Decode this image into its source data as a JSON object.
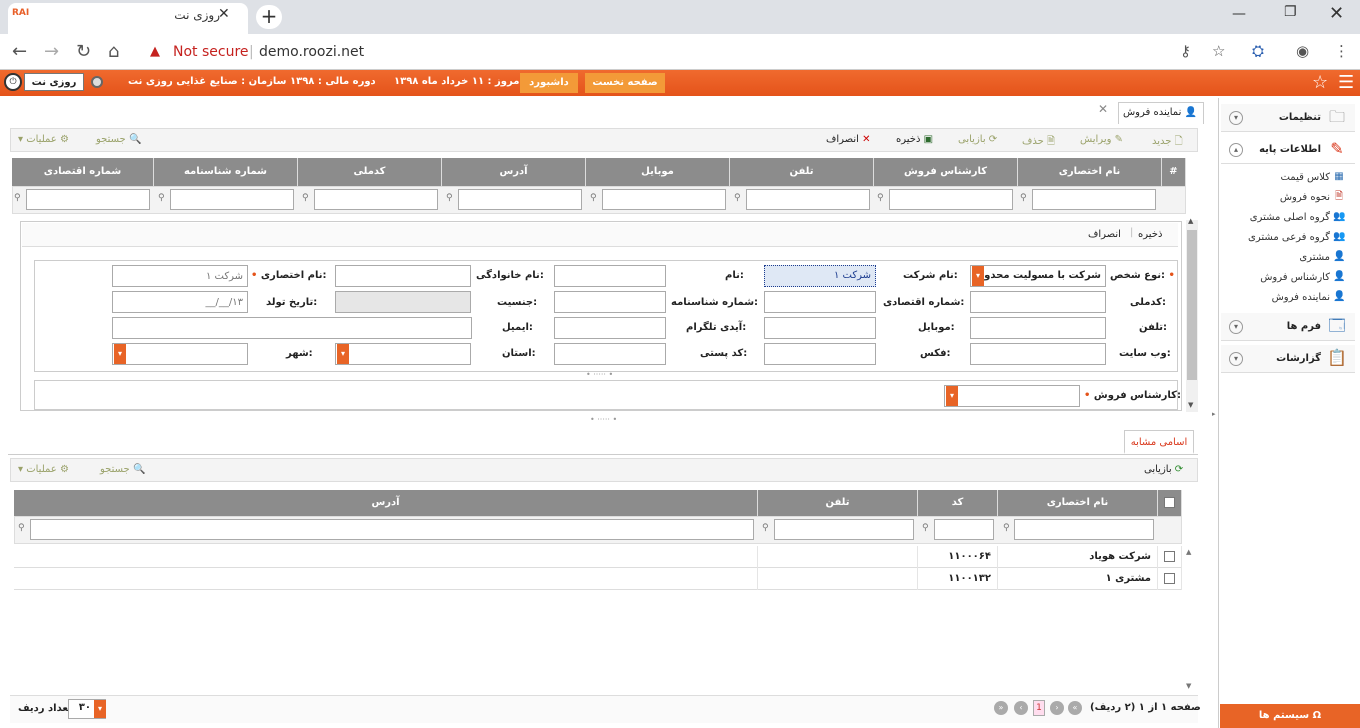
{
  "browser": {
    "tab_title": "روزی نت",
    "favicon_text": "RAI",
    "url_warning": "Not secure",
    "url_host": "demo.roozi.net"
  },
  "appbar": {
    "brand": "روزی نت",
    "organization": "سازمان : صنایع غذایی روزی نت",
    "fiscal_year": "دوره مالی : ۱۳۹۸",
    "today": "امروز : ۱۱ خرداد ماه ۱۳۹۸",
    "dashboard": "داشبورد",
    "home": "صفحه نخست"
  },
  "page_tab": "نماینده فروش",
  "toolbar": {
    "new": "جدید",
    "edit": "ویرایش",
    "delete": "حذف",
    "refresh": "بازیابی",
    "save": "ذخیره",
    "cancel": "انصراف",
    "search": "جستجو",
    "operations": "عملیات"
  },
  "grid": {
    "hash": "#",
    "columns": [
      "نام اختصاری",
      "کارشناس فروش",
      "تلفن",
      "موبایل",
      "آدرس",
      "کدملی",
      "شماره شناسنامه",
      "شماره اقتصادی"
    ]
  },
  "form": {
    "save": "ذخیره",
    "cancel": "انصراف",
    "person_type_label": "نوع شخص:",
    "person_type_value": "شرکت با مسولیت محدود",
    "company_name_label": "نام شرکت:",
    "company_name_value": "شرکت ۱",
    "first_name_label": "نام:",
    "last_name_label": "نام خانوادگی:",
    "short_name_label": "نام اختصاری:",
    "short_name_placeholder": "شرکت ۱",
    "national_id_label": "کدملی:",
    "economic_no_label": "شماره اقتصادی:",
    "id_no_label": "شماره شناسنامه:",
    "gender_label": "جنسیت:",
    "birth_label": "تاریخ تولد:",
    "birth_placeholder": "__/__/۱۳",
    "phone_label": "تلفن:",
    "mobile_label": "موبایل:",
    "telegram_label": "آیدی تلگرام:",
    "email_label": "ایمیل:",
    "website_label": "وب سایت:",
    "fax_label": "فکس:",
    "postal_label": "کد پستی:",
    "province_label": "استان:",
    "city_label": "شهر:",
    "sales_expert_label": "کارشناس فروش:"
  },
  "similar": {
    "tab": "اسامی مشابه",
    "refresh": "بازیابی",
    "search": "جستجو",
    "operations": "عملیات",
    "columns": [
      "نام اختصاری",
      "کد",
      "تلفن",
      "آدرس"
    ],
    "rows": [
      {
        "name": "شرکت هویاد",
        "code": "۱۱۰۰۰۶۴",
        "phone": "",
        "address": ""
      },
      {
        "name": "مشتری ۱",
        "code": "۱۱۰۰۱۳۲",
        "phone": "",
        "address": ""
      }
    ]
  },
  "pager": {
    "summary": "صفحه ۱ از ۱ (۲ ردیف)",
    "current_page": "1",
    "rows_label": "تعداد ردیف",
    "rows_value": "۳۰"
  },
  "sidebar": {
    "settings": "تنظیمات",
    "base_info": "اطلاعات پایه",
    "items": [
      "کلاس قیمت",
      "نحوه فروش",
      "گروه اصلی مشتری",
      "گروه فرعی مشتری",
      "مشتری",
      "کارشناس فروش",
      "نماینده فروش"
    ],
    "forms": "فرم ها",
    "reports": "گزارشات",
    "systems": "سیستم ها"
  }
}
